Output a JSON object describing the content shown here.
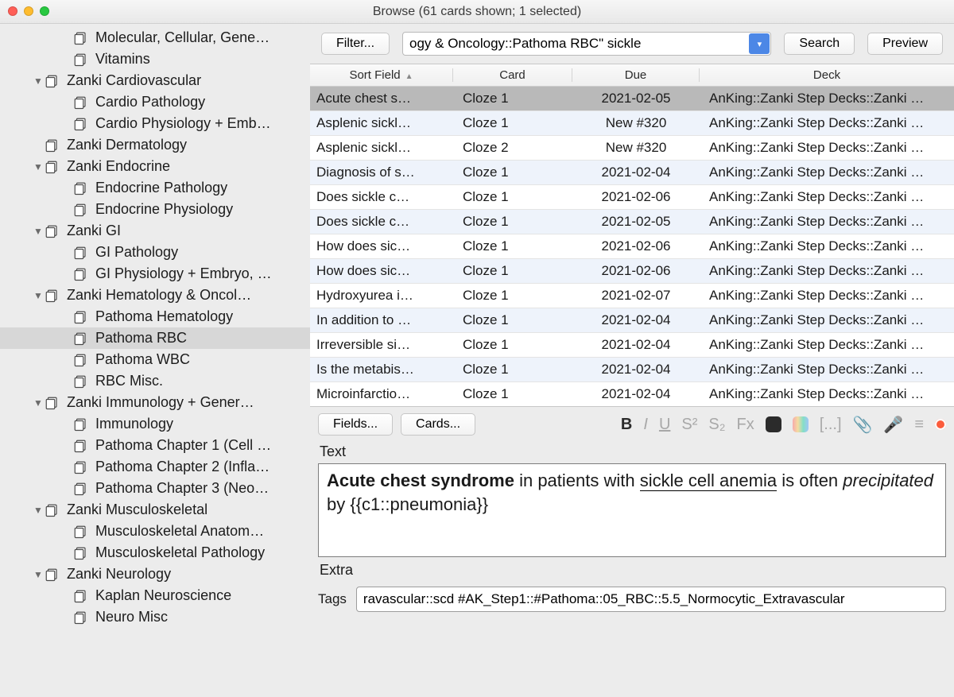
{
  "title": "Browse (61 cards shown; 1 selected)",
  "toolbar": {
    "filter": "Filter...",
    "search_value": "ogy & Oncology::Pathoma RBC\" sickle",
    "search_btn": "Search",
    "preview_btn": "Preview"
  },
  "sidebar": [
    {
      "indent": 2,
      "expand": "",
      "label": "Molecular, Cellular, Gene…"
    },
    {
      "indent": 2,
      "expand": "",
      "label": "Vitamins"
    },
    {
      "indent": 1,
      "expand": "▼",
      "label": "Zanki Cardiovascular"
    },
    {
      "indent": 2,
      "expand": "",
      "label": "Cardio Pathology"
    },
    {
      "indent": 2,
      "expand": "",
      "label": "Cardio Physiology + Emb…"
    },
    {
      "indent": 1,
      "expand": "",
      "label": "Zanki Dermatology"
    },
    {
      "indent": 1,
      "expand": "▼",
      "label": "Zanki Endocrine"
    },
    {
      "indent": 2,
      "expand": "",
      "label": "Endocrine Pathology"
    },
    {
      "indent": 2,
      "expand": "",
      "label": "Endocrine Physiology"
    },
    {
      "indent": 1,
      "expand": "▼",
      "label": "Zanki GI"
    },
    {
      "indent": 2,
      "expand": "",
      "label": "GI Pathology"
    },
    {
      "indent": 2,
      "expand": "",
      "label": "GI Physiology + Embryo, …"
    },
    {
      "indent": 1,
      "expand": "▼",
      "label": "Zanki Hematology & Oncol…"
    },
    {
      "indent": 2,
      "expand": "",
      "label": "Pathoma Hematology"
    },
    {
      "indent": 2,
      "expand": "",
      "label": "Pathoma RBC",
      "selected": true
    },
    {
      "indent": 2,
      "expand": "",
      "label": "Pathoma WBC"
    },
    {
      "indent": 2,
      "expand": "",
      "label": "RBC Misc."
    },
    {
      "indent": 1,
      "expand": "▼",
      "label": "Zanki Immunology + Gener…"
    },
    {
      "indent": 2,
      "expand": "",
      "label": "Immunology"
    },
    {
      "indent": 2,
      "expand": "",
      "label": "Pathoma Chapter 1 (Cell …"
    },
    {
      "indent": 2,
      "expand": "",
      "label": "Pathoma Chapter 2 (Infla…"
    },
    {
      "indent": 2,
      "expand": "",
      "label": "Pathoma Chapter 3 (Neo…"
    },
    {
      "indent": 1,
      "expand": "▼",
      "label": "Zanki Musculoskeletal"
    },
    {
      "indent": 2,
      "expand": "",
      "label": "Musculoskeletal Anatom…"
    },
    {
      "indent": 2,
      "expand": "",
      "label": "Musculoskeletal Pathology"
    },
    {
      "indent": 1,
      "expand": "▼",
      "label": "Zanki Neurology"
    },
    {
      "indent": 2,
      "expand": "",
      "label": "Kaplan Neuroscience"
    },
    {
      "indent": 2,
      "expand": "",
      "label": "Neuro Misc"
    }
  ],
  "table": {
    "headers": [
      "Sort Field",
      "Card",
      "Due",
      "Deck"
    ],
    "sort_col": 0,
    "sort_dir": "▲",
    "rows": [
      {
        "sort": "Acute chest s…",
        "card": "Cloze 1",
        "due": "2021-02-05",
        "deck": "AnKing::Zanki Step Decks::Zanki …",
        "selected": true
      },
      {
        "sort": "Asplenic sickl…",
        "card": "Cloze 1",
        "due": "New #320",
        "deck": "AnKing::Zanki Step Decks::Zanki …"
      },
      {
        "sort": "Asplenic sickl…",
        "card": "Cloze 2",
        "due": "New #320",
        "deck": "AnKing::Zanki Step Decks::Zanki …"
      },
      {
        "sort": "Diagnosis of s…",
        "card": "Cloze 1",
        "due": "2021-02-04",
        "deck": "AnKing::Zanki Step Decks::Zanki …"
      },
      {
        "sort": "Does sickle c…",
        "card": "Cloze 1",
        "due": "2021-02-06",
        "deck": "AnKing::Zanki Step Decks::Zanki …"
      },
      {
        "sort": "Does sickle c…",
        "card": "Cloze 1",
        "due": "2021-02-05",
        "deck": "AnKing::Zanki Step Decks::Zanki …"
      },
      {
        "sort": "How does sic…",
        "card": "Cloze 1",
        "due": "2021-02-06",
        "deck": "AnKing::Zanki Step Decks::Zanki …"
      },
      {
        "sort": "How does sic…",
        "card": "Cloze 1",
        "due": "2021-02-06",
        "deck": "AnKing::Zanki Step Decks::Zanki …"
      },
      {
        "sort": "Hydroxyurea i…",
        "card": "Cloze 1",
        "due": "2021-02-07",
        "deck": "AnKing::Zanki Step Decks::Zanki …"
      },
      {
        "sort": "In addition to …",
        "card": "Cloze 1",
        "due": "2021-02-04",
        "deck": "AnKing::Zanki Step Decks::Zanki …"
      },
      {
        "sort": "Irreversible si…",
        "card": "Cloze 1",
        "due": "2021-02-04",
        "deck": "AnKing::Zanki Step Decks::Zanki …"
      },
      {
        "sort": "Is the metabis…",
        "card": "Cloze 1",
        "due": "2021-02-04",
        "deck": "AnKing::Zanki Step Decks::Zanki …"
      },
      {
        "sort": "Microinfarctio…",
        "card": "Cloze 1",
        "due": "2021-02-04",
        "deck": "AnKing::Zanki Step Decks::Zanki …"
      }
    ]
  },
  "editor": {
    "fields_btn": "Fields...",
    "cards_btn": "Cards...",
    "text_label": "Text",
    "text_html": "<span class='bold'>Acute chest syndrome</span> in patients with <span class='uline'>sickle cell anemia</span> is often <span class='ital'>precipitated</span> by {{c1::pneumonia}}",
    "extra_label": "Extra",
    "tags_label": "Tags",
    "tags_value": "ravascular::scd #AK_Step1::#Pathoma::05_RBC::5.5_Normocytic_Extravascular"
  },
  "fmt_icons": {
    "bold": "B",
    "italic": "I",
    "underline": "U",
    "sup": "S²",
    "sub": "S₂",
    "clear": "Fx",
    "cloze": "[...]",
    "clip": "📎",
    "mic": "🎤",
    "more": "≡"
  }
}
